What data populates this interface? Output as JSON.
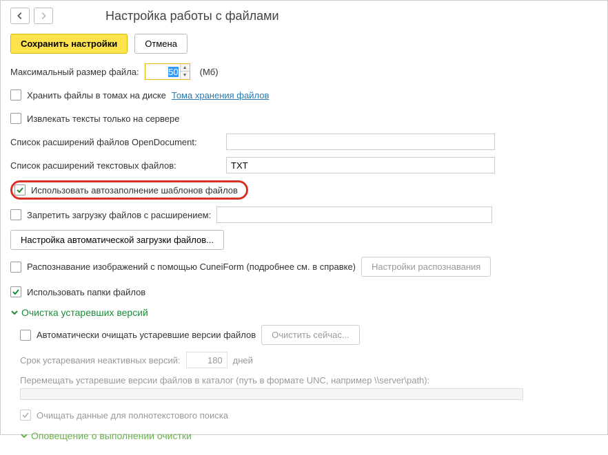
{
  "title": "Настройка работы с файлами",
  "toolbar": {
    "save": "Сохранить настройки",
    "cancel": "Отмена"
  },
  "maxFileSize": {
    "label": "Максимальный размер файла:",
    "value": "50",
    "unit": "(Мб)"
  },
  "storeInVolumes": {
    "label": "Хранить файлы в томах на диске",
    "link": "Тома хранения файлов"
  },
  "extractServerOnly": "Извлекать тексты только на сервере",
  "openDocExtensions": {
    "label": "Список расширений файлов OpenDocument:",
    "value": ""
  },
  "textExtensions": {
    "label": "Список расширений текстовых файлов:",
    "value": "TXT"
  },
  "useTemplateAutofill": "Использовать автозаполнение шаблонов файлов",
  "restrictUpload": {
    "label": "Запретить загрузку файлов с расширением:",
    "value": ""
  },
  "autoLoadSettings": "Настройка автоматической загрузки файлов...",
  "cuneiform": {
    "label": "Распознавание изображений с помощью CuneiForm (подробнее см. в справке)",
    "button": "Настройки распознавания"
  },
  "useFileFolders": "Использовать папки файлов",
  "sections": {
    "cleanup": "Очистка устаревших версий",
    "notification": "Оповещение о выполнении очистки"
  },
  "autoCleanup": {
    "label": "Автоматически очищать устаревшие версии файлов",
    "button": "Очистить сейчас..."
  },
  "inactiveAge": {
    "label": "Срок устаревания неактивных версий:",
    "value": "180",
    "unit": "дней"
  },
  "moveToPath": {
    "label": "Перемещать устаревшие версии файлов в каталог (путь в формате UNC, например \\\\server\\path):",
    "value": ""
  },
  "cleanFulltext": "Очищать данные для полнотекстового поиска"
}
